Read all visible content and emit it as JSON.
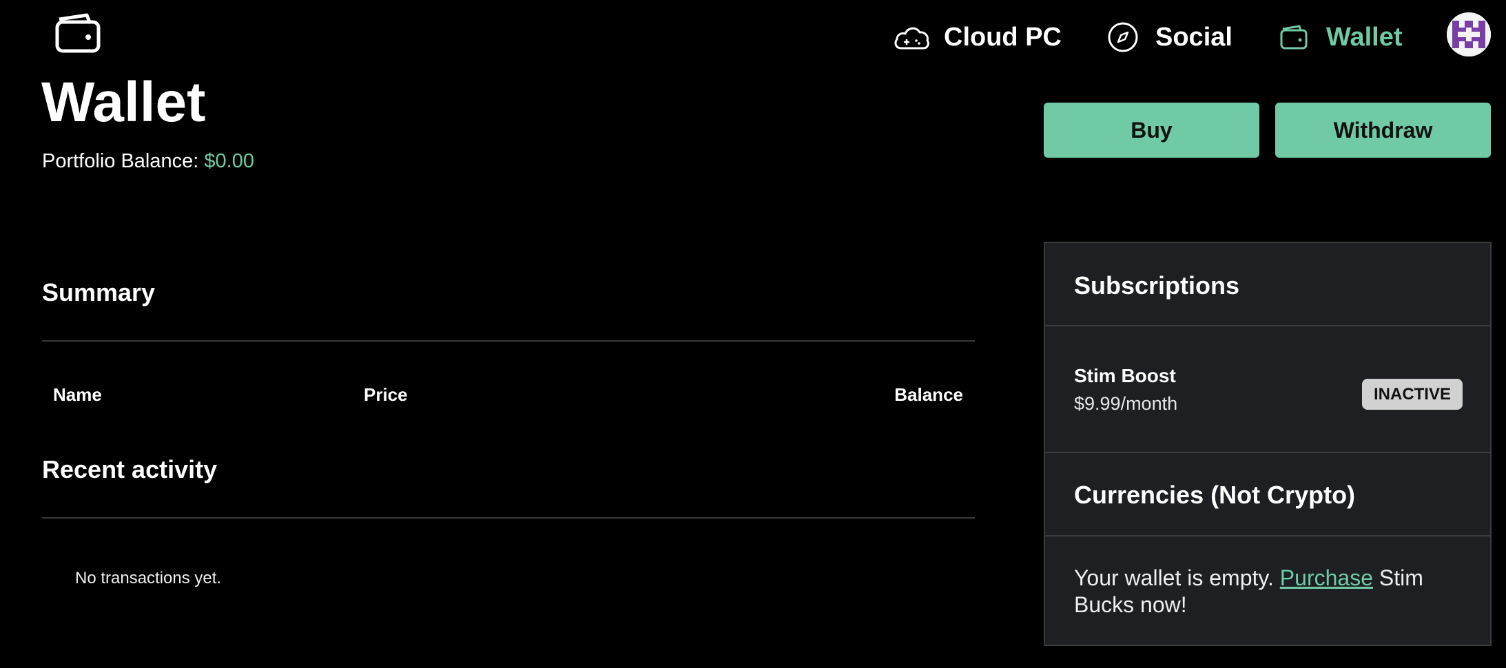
{
  "nav": {
    "cloud_label": "Cloud PC",
    "social_label": "Social",
    "wallet_label": "Wallet",
    "active": "wallet",
    "accent": "#6fcaa5"
  },
  "icons": {
    "logo": "wallet-icon",
    "cloud": "cloud-gamepad-icon",
    "social": "compass-icon",
    "wallet": "wallet-icon",
    "avatar": "pixel-avatar"
  },
  "page": {
    "title": "Wallet",
    "balance_label": "Portfolio Balance:",
    "balance_value": "$0.00"
  },
  "actions": {
    "buy_label": "Buy",
    "withdraw_label": "Withdraw"
  },
  "summary": {
    "title": "Summary",
    "columns": [
      "Name",
      "Price",
      "Balance"
    ]
  },
  "activity": {
    "title": "Recent activity",
    "empty_text": "No transactions yet."
  },
  "subscriptions": {
    "title": "Subscriptions",
    "items": [
      {
        "name": "Stim Boost",
        "price": "$9.99/month",
        "status": "INACTIVE"
      }
    ]
  },
  "currencies": {
    "title": "Currencies (Not Crypto)",
    "empty_prefix": "Your wallet is empty.",
    "link_text": "Purchase",
    "empty_suffix": "Stim Bucks now!"
  },
  "colors": {
    "background": "#000000",
    "accent": "#6fcaa5",
    "panel": "#1e1f22",
    "avatar_purple": "#7a3fa6"
  }
}
